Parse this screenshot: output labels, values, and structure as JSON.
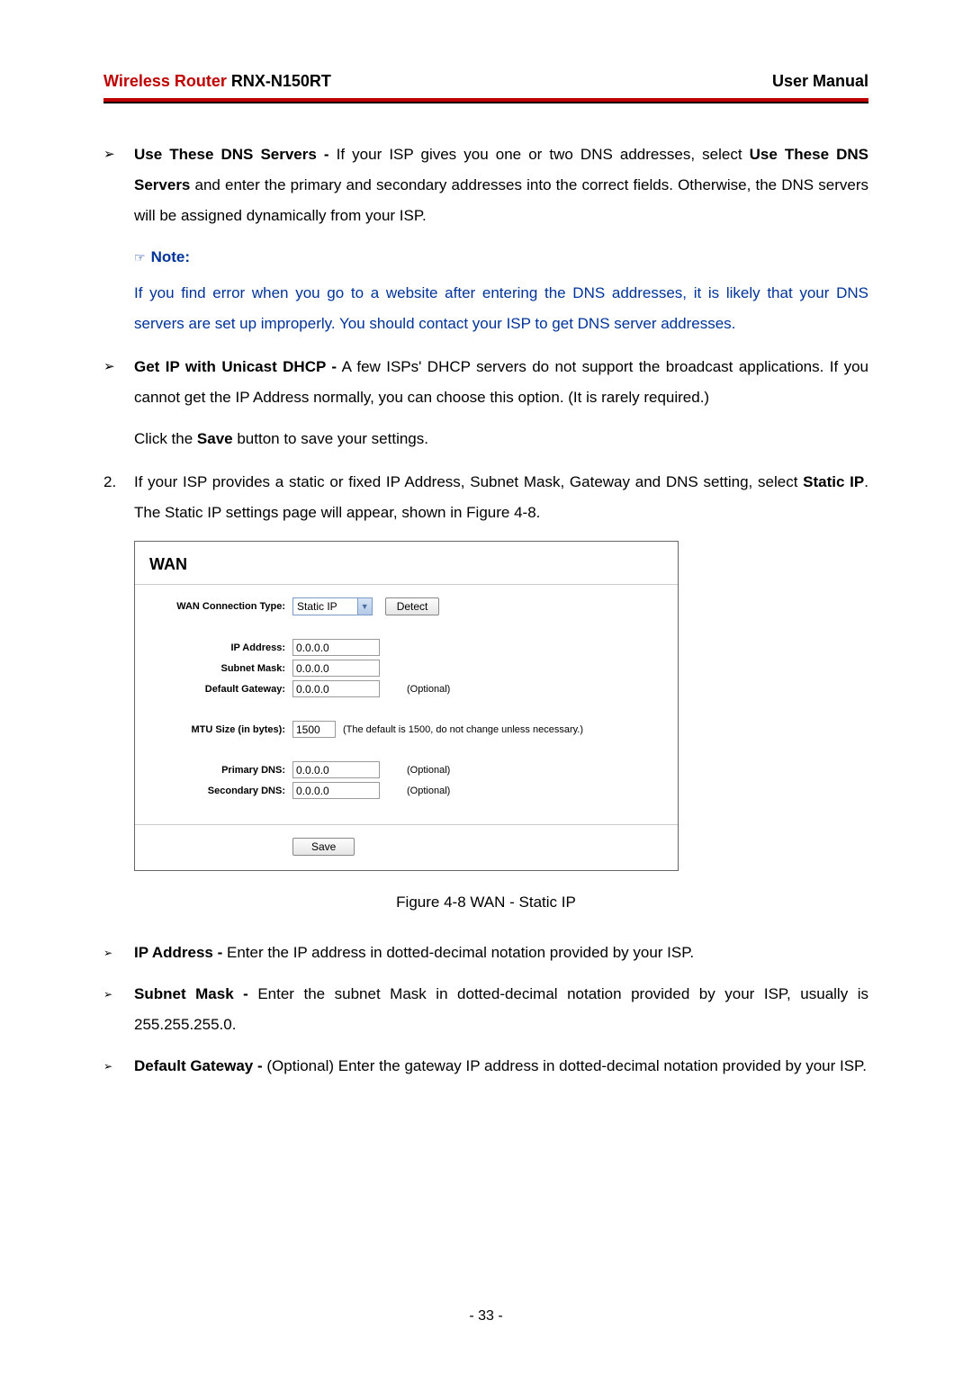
{
  "header": {
    "title_red": "Wireless Router",
    "title_model": "   RNX-N150RT",
    "right": "User Manual"
  },
  "bullets": {
    "b1_bold1": "Use These DNS Servers -",
    "b1_part1": " If your ISP gives you one or two DNS addresses, select ",
    "b1_bold2": "Use These DNS Servers",
    "b1_part2": " and enter the primary and secondary addresses into the correct fields. Otherwise, the DNS servers will be assigned dynamically from your ISP.",
    "b2_bold": "Get IP with Unicast DHCP -",
    "b2_text": " A few ISPs' DHCP servers do not support the broadcast applications. If you cannot get the IP Address normally, you can choose this option. (It is rarely required.)",
    "b3_bold": "IP Address -",
    "b3_text": " Enter the IP address in dotted-decimal notation provided by your ISP.",
    "b4_bold": "Subnet Mask -",
    "b4_text": " Enter the subnet Mask in dotted-decimal notation provided by your ISP, usually is 255.255.255.0.",
    "b5_bold": "Default Gateway -",
    "b5_text": " (Optional) Enter the gateway IP address in dotted-decimal notation provided by your ISP."
  },
  "note": {
    "label": "Note:",
    "body": "If you find error when you go to a website after entering the DNS addresses, it is likely that your DNS servers are set up improperly. You should contact your ISP to get DNS server addresses."
  },
  "para_save_pre": "Click the ",
  "para_save_bold": "Save",
  "para_save_post": " button to save your settings.",
  "numbered": {
    "num": "2.",
    "pre": "If your ISP provides a static or fixed IP Address, Subnet Mask, Gateway and DNS setting, select ",
    "bold": "Static IP",
    "post": ". The Static IP settings page will appear, shown in Figure 4-8."
  },
  "wan": {
    "title": "WAN",
    "labels": {
      "conn_type": "WAN Connection Type:",
      "ip": "IP Address:",
      "subnet": "Subnet Mask:",
      "gateway": "Default Gateway:",
      "mtu": "MTU Size (in bytes):",
      "pdns": "Primary DNS:",
      "sdns": "Secondary DNS:"
    },
    "values": {
      "conn_type": "Static IP",
      "ip": "0.0.0.0",
      "subnet": "0.0.0.0",
      "gateway": "0.0.0.0",
      "mtu": "1500",
      "pdns": "0.0.0.0",
      "sdns": "0.0.0.0"
    },
    "buttons": {
      "detect": "Detect",
      "save": "Save"
    },
    "notes": {
      "optional": "(Optional)",
      "mtu": "(The default is 1500, do not change unless necessary.)"
    }
  },
  "caption": "Figure 4-8    WAN - Static IP",
  "page_number": "- 33 -"
}
